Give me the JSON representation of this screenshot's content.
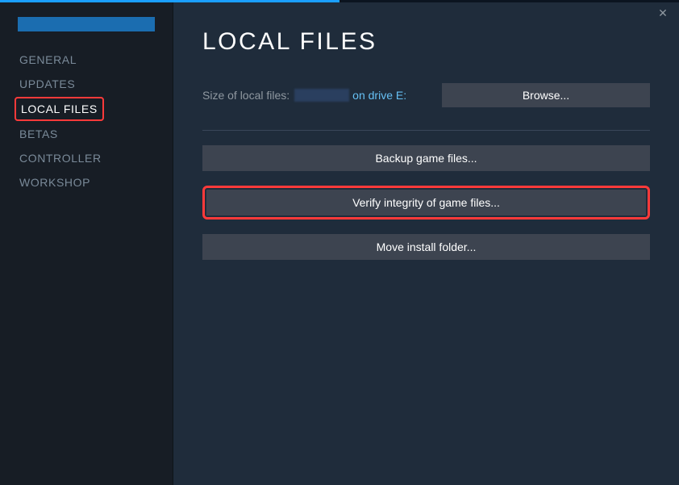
{
  "header": {
    "title": "LOCAL FILES"
  },
  "sidebar": {
    "items": [
      {
        "label": "GENERAL"
      },
      {
        "label": "UPDATES"
      },
      {
        "label": "LOCAL FILES"
      },
      {
        "label": "BETAS"
      },
      {
        "label": "CONTROLLER"
      },
      {
        "label": "WORKSHOP"
      }
    ]
  },
  "info": {
    "size_label": "Size of local files:",
    "drive_label": "on drive E:"
  },
  "buttons": {
    "browse": "Browse...",
    "backup": "Backup game files...",
    "verify": "Verify integrity of game files...",
    "move": "Move install folder..."
  }
}
